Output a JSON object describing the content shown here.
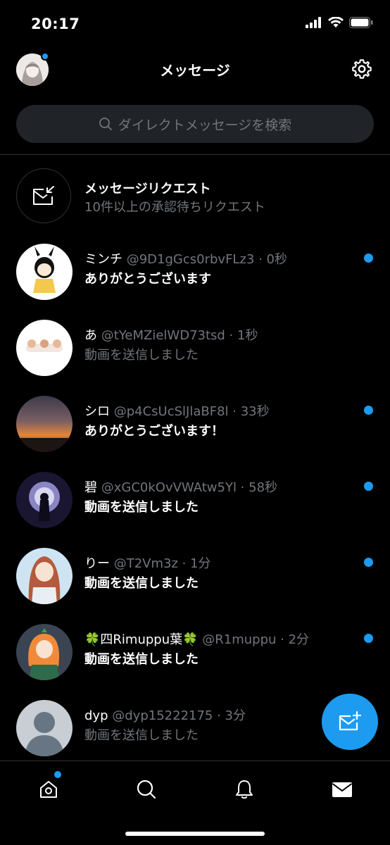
{
  "status_bar": {
    "time": "20:17"
  },
  "header": {
    "title": "メッセージ",
    "avatar_icon": "profile-avatar",
    "settings_icon": "gear-icon"
  },
  "search": {
    "placeholder": "ダイレクトメッセージを検索"
  },
  "message_request": {
    "title": "メッセージリクエスト",
    "subtitle": "10件以上の承認待ちリクエスト"
  },
  "conversations": [
    {
      "name": "ミンチ",
      "meta": "@9D1gGcs0rbvFLz3 · 0秒",
      "preview": "ありがとうございます",
      "unread": true
    },
    {
      "name": "あ",
      "meta": "@tYeMZielWD73tsd · 1秒",
      "preview": "動画を送信しました",
      "unread": false
    },
    {
      "name": "シロ",
      "meta": "@p4CsUcSlJlaBF8l · 33秒",
      "preview": "ありがとうございます！",
      "unread": true
    },
    {
      "name": "碧",
      "meta": "@xGC0kOvVWAtw5Yl · 58秒",
      "preview": "動画を送信しました",
      "unread": true
    },
    {
      "name": "りー",
      "meta": "@T2Vm3z · 1分",
      "preview": "動画を送信しました",
      "unread": true
    },
    {
      "name": "🍀四Rimuppu葉🍀",
      "meta": "@R1muppu · 2分",
      "preview": "動画を送信しました",
      "unread": true
    },
    {
      "name": "dyp",
      "meta": "@dyp15222175 · 3分",
      "preview": "動画を送信しました",
      "unread": false
    }
  ],
  "colors": {
    "accent": "#1d9bf0",
    "background": "#000000",
    "muted": "#71767b"
  },
  "tabs": [
    "home-icon",
    "search-icon",
    "notifications-icon",
    "messages-icon"
  ]
}
